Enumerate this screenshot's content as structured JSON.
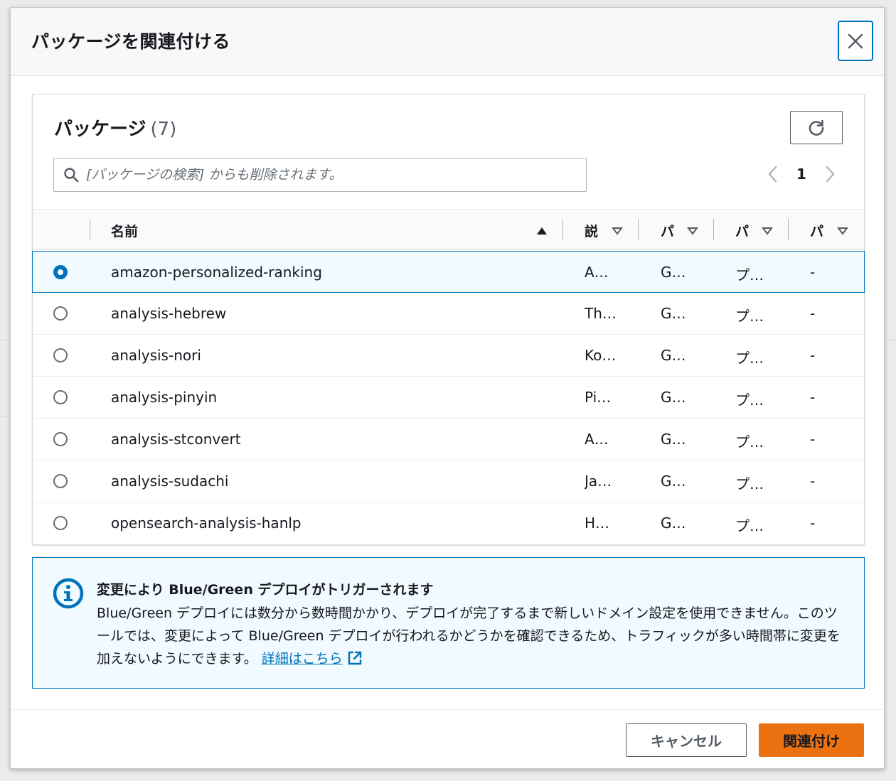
{
  "modal": {
    "title": "パッケージを関連付ける"
  },
  "packages_table": {
    "heading": "パッケージ",
    "count": "(7)",
    "search_placeholder": "[パッケージの検索] からも削除されます。",
    "pagination": {
      "current_page": "1"
    },
    "columns": [
      {
        "label": "名前",
        "sort": "ascending"
      },
      {
        "label": "説"
      },
      {
        "label": "パ"
      },
      {
        "label": "パ"
      },
      {
        "label": "パ"
      }
    ],
    "rows": [
      {
        "selected": true,
        "name": "amazon-personalized-ranking",
        "desc": "A…",
        "p1": "G…",
        "p2": "プ…",
        "p3": "-"
      },
      {
        "selected": false,
        "name": "analysis-hebrew",
        "desc": "Th…",
        "p1": "G…",
        "p2": "プ…",
        "p3": "-"
      },
      {
        "selected": false,
        "name": "analysis-nori",
        "desc": "Ko…",
        "p1": "G…",
        "p2": "プ…",
        "p3": "-"
      },
      {
        "selected": false,
        "name": "analysis-pinyin",
        "desc": "Pi…",
        "p1": "G…",
        "p2": "プ…",
        "p3": "-"
      },
      {
        "selected": false,
        "name": "analysis-stconvert",
        "desc": "A…",
        "p1": "G…",
        "p2": "プ…",
        "p3": "-"
      },
      {
        "selected": false,
        "name": "analysis-sudachi",
        "desc": "Ja…",
        "p1": "G…",
        "p2": "プ…",
        "p3": "-"
      },
      {
        "selected": false,
        "name": "opensearch-analysis-hanlp",
        "desc": "H…",
        "p1": "G…",
        "p2": "プ…",
        "p3": "-"
      }
    ]
  },
  "alert": {
    "title": "変更により Blue/Green デプロイがトリガーされます",
    "body": "Blue/Green デプロイには数分から数時間かかり、デプロイが完了するまで新しいドメイン設定を使用できません。このツールでは、変更によって Blue/Green デプロイが行われるかどうかを確認できるため、トラフィックが多い時間帯に変更を加えないようにできます。",
    "link_label": "詳細はこちら"
  },
  "footer": {
    "cancel_label": "キャンセル",
    "submit_label": "関連付け"
  },
  "colors": {
    "accent": "#0073bb",
    "primary_button": "#ec7211",
    "selected_row_bg": "#f1faff"
  },
  "icons": [
    "close-icon",
    "refresh-icon",
    "search-icon",
    "chevron-left-icon",
    "chevron-right-icon",
    "sort-ascending-icon",
    "sort-descending-icon",
    "info-icon",
    "external-link-icon"
  ]
}
